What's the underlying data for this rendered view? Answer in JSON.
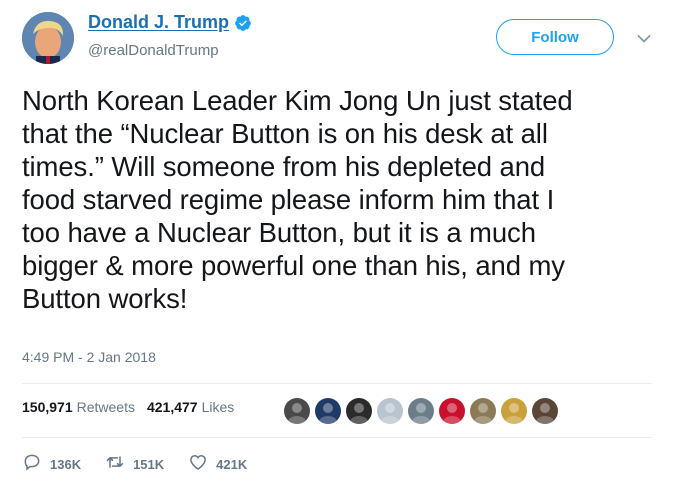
{
  "user": {
    "display_name": "Donald J. Trump",
    "handle": "@realDonaldTrump",
    "verified": true
  },
  "follow_button": {
    "label": "Follow"
  },
  "tweet": {
    "text": "North Korean Leader Kim Jong Un just stated\nthat the “Nuclear Button is on his desk at all\ntimes.” Will someone from his depleted and\nfood starved regime please inform him that I\ntoo have a Nuclear Button, but it is a much\nbigger & more powerful one than his, and my\nButton works!",
    "timestamp": "4:49 PM - 2 Jan 2018"
  },
  "stats": {
    "retweets_count": "150,971",
    "retweets_label": "Retweets",
    "likes_count": "421,477",
    "likes_label": "Likes"
  },
  "actions": {
    "replies": "136K",
    "retweets": "151K",
    "likes": "421K"
  },
  "colors": {
    "accent": "#1da1f2",
    "name_link": "#1c6fb5",
    "muted": "#657786",
    "divider": "#e6ecf0"
  },
  "likers": [
    {
      "avatar": "avatar-1",
      "color": "#4a4a4a"
    },
    {
      "avatar": "avatar-2",
      "color": "#1f3a66"
    },
    {
      "avatar": "avatar-3",
      "color": "#2b2b2b"
    },
    {
      "avatar": "avatar-4",
      "color": "#b8c4cf"
    },
    {
      "avatar": "avatar-5",
      "color": "#6b7c8a"
    },
    {
      "avatar": "avatar-6",
      "color": "#c8102e"
    },
    {
      "avatar": "avatar-7",
      "color": "#8a7a55"
    },
    {
      "avatar": "avatar-8",
      "color": "#c9a13a"
    },
    {
      "avatar": "avatar-9",
      "color": "#5a4638"
    }
  ]
}
